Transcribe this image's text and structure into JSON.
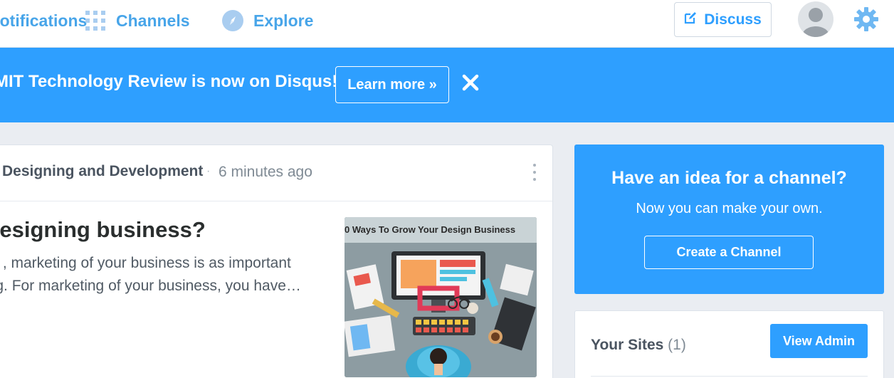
{
  "topnav": {
    "notifications_label": "Notifications",
    "channels_label": "Channels",
    "explore_label": "Explore",
    "discuss_label": "Discuss"
  },
  "banner": {
    "message": "MIT Technology Review is now on Disqus!",
    "learn_more_label": "Learn more »"
  },
  "feed": {
    "channel": "Designing and Development",
    "separator": "·",
    "time_ago": "6 minutes ago",
    "post_title": "Designing business?",
    "excerpt_line1": "ss , marketing of your business is as important",
    "excerpt_line2": "ing. For marketing of your business, you have…",
    "thumbnail_caption": "0 Ways To Grow Your Design Business"
  },
  "promo": {
    "title": "Have an idea for a channel?",
    "subtitle": "Now you can make your own.",
    "button_label": "Create a Channel"
  },
  "your_sites": {
    "title": "Your Sites",
    "count": "(1)",
    "button_label": "View Admin"
  },
  "colors": {
    "brand_blue": "#2e9fff",
    "nav_link_blue": "#48a5e9",
    "page_bg": "#eaedf2"
  },
  "icons": {
    "channels": "grid-icon",
    "explore": "compass-icon",
    "discuss": "edit-icon",
    "settings": "gear-icon",
    "close": "close-icon",
    "more": "more-vertical-icon"
  }
}
